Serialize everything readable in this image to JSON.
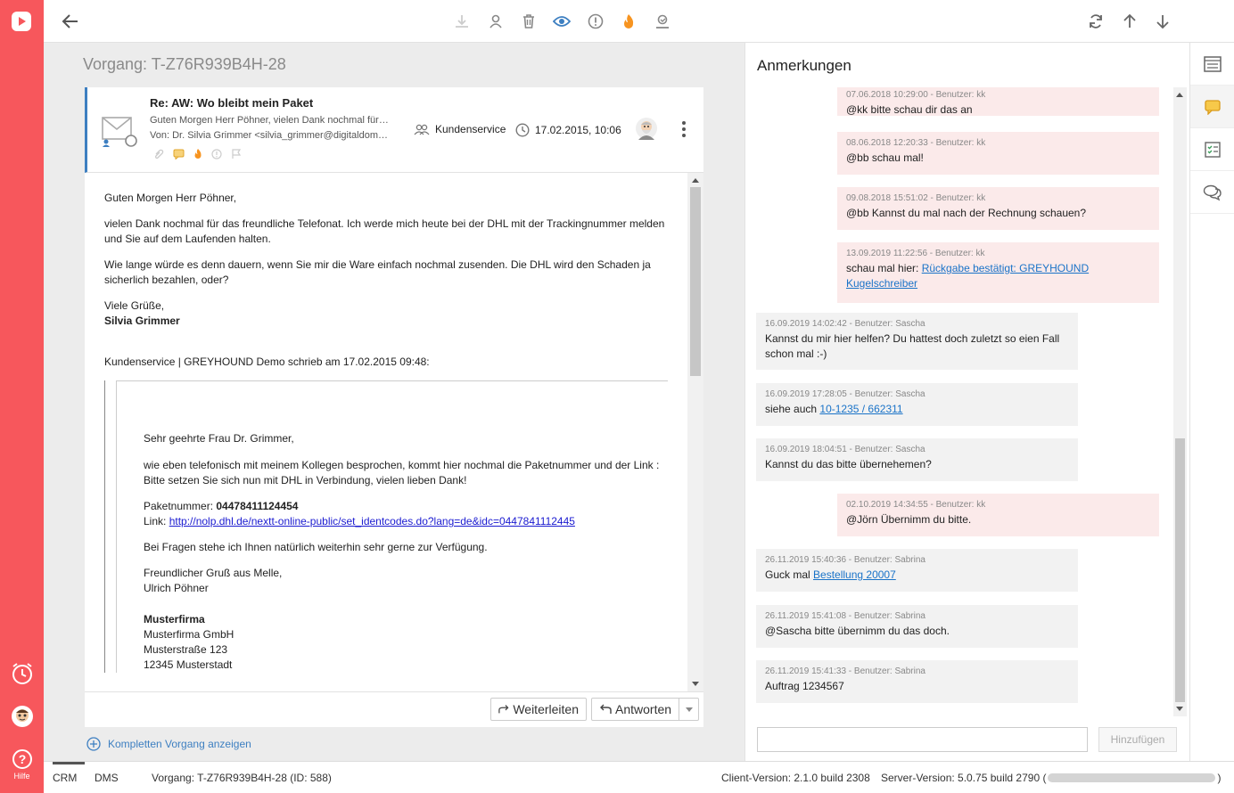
{
  "rail": {
    "help_label": "Hilfe"
  },
  "main": {
    "title": "Vorgang: T-Z76R939B4H-28"
  },
  "mail": {
    "subject": "Re: AW: Wo bleibt mein Paket",
    "preview": "Guten Morgen Herr Pöhner, vielen Dank nochmal für das freundliche Telefonat.",
    "from": "Von: Dr. Silvia Grimmer <silvia_grimmer@digitaldome.de>",
    "team": "Kundenservice",
    "datetime": "17.02.2015, 10:06",
    "body": {
      "greeting": "Guten Morgen Herr Pöhner,",
      "p1": "vielen Dank nochmal für das freundliche Telefonat. Ich werde mich heute bei der DHL mit der Trackingnummer melden und Sie auf dem Laufenden halten.",
      "p2": "Wie lange würde es denn dauern, wenn Sie mir die Ware einfach nochmal zusenden. Die DHL wird den Schaden ja sicherlich bezahlen, oder?",
      "closing": "Viele Grüße,",
      "signature": "Silvia Grimmer",
      "quote_header": "Kundenservice | GREYHOUND Demo schrieb am 17.02.2015 09:48:",
      "q_greeting": "Sehr geehrte Frau Dr. Grimmer,",
      "q_p1": "wie eben telefonisch mit meinem Kollegen besprochen, kommt hier nochmal die Paketnummer und der Link :",
      "q_p1b": "Bitte setzen Sie sich nun mit DHL in Verbindung, vielen lieben Dank!",
      "q_paket_label": "Paketnummer: ",
      "q_paket_value": "04478411124454",
      "q_link_label": "Link: ",
      "q_link": "http://nolp.dhl.de/nextt-online-public/set_identcodes.do?lang=de&idc=0447841112445",
      "q_p2": "Bei Fragen stehe ich Ihnen natürlich weiterhin sehr gerne zur Verfügung.",
      "q_closing1": "Freundlicher Gruß aus Melle,",
      "q_closing2": "Ulrich Pöhner",
      "q_company_bold": "Musterfirma",
      "q_company": "Musterfirma GmbH",
      "q_street": "Musterstraße 123",
      "q_city": "12345 Musterstadt"
    },
    "forward_label": "Weiterleiten",
    "reply_label": "Antworten"
  },
  "show_all_label": "Kompletten Vorgang anzeigen",
  "panel": {
    "title": "Anmerkungen",
    "comments": [
      {
        "own": true,
        "meta": "07.06.2018 10:29:00 - Benutzer: kk",
        "text": "@kk bitte schau dir das an"
      },
      {
        "own": true,
        "meta": "08.06.2018 12:20:33 - Benutzer: kk",
        "text": "@bb schau mal!"
      },
      {
        "own": true,
        "meta": "09.08.2018 15:51:02 - Benutzer: kk",
        "text": "@bb Kannst du mal nach der Rechnung schauen?"
      },
      {
        "own": true,
        "meta": "13.09.2019 11:22:56 - Benutzer: kk",
        "text": "schau mal hier: ",
        "link": "Rückgabe bestätigt: GREYHOUND Kugelschreiber"
      },
      {
        "own": false,
        "meta": "16.09.2019 14:02:42 - Benutzer: Sascha",
        "text": "Kannst du mir hier helfen? Du hattest doch zuletzt so eien Fall schon mal :-)"
      },
      {
        "own": false,
        "meta": "16.09.2019 17:28:05 - Benutzer: Sascha",
        "text": "siehe auch ",
        "link": "10-1235 / 662311"
      },
      {
        "own": false,
        "meta": "16.09.2019 18:04:51 - Benutzer: Sascha",
        "text": "Kannst du das bitte übernehemen?"
      },
      {
        "own": true,
        "meta": "02.10.2019 14:34:55 - Benutzer: kk",
        "text": "@Jörn Übernimm du bitte."
      },
      {
        "own": false,
        "meta": "26.11.2019 15:40:36 - Benutzer: Sabrina",
        "text": "Guck mal ",
        "link": "Bestellung 20007"
      },
      {
        "own": false,
        "meta": "26.11.2019 15:41:08 - Benutzer: Sabrina",
        "text": "@Sascha bitte übernimm du das doch."
      },
      {
        "own": false,
        "meta": "26.11.2019 15:41:33 - Benutzer: Sabrina",
        "text": "Auftrag 1234567"
      }
    ],
    "input_placeholder": "",
    "add_label": "Hinzufügen"
  },
  "statusbar": {
    "tab_crm": "CRM",
    "tab_dms": "DMS",
    "vorgang": "Vorgang: T-Z76R939B4H-28 (ID: 588)",
    "client": "Client-Version: 2.1.0 build 2308",
    "server_prefix": "Server-Version: 5.0.75 build 2790 (",
    "server_suffix": ")"
  },
  "colors": {
    "accent": "#f7575c",
    "blue": "#3d7fc1",
    "own_comment": "#fbeaea",
    "other_comment": "#f2f2f2"
  }
}
